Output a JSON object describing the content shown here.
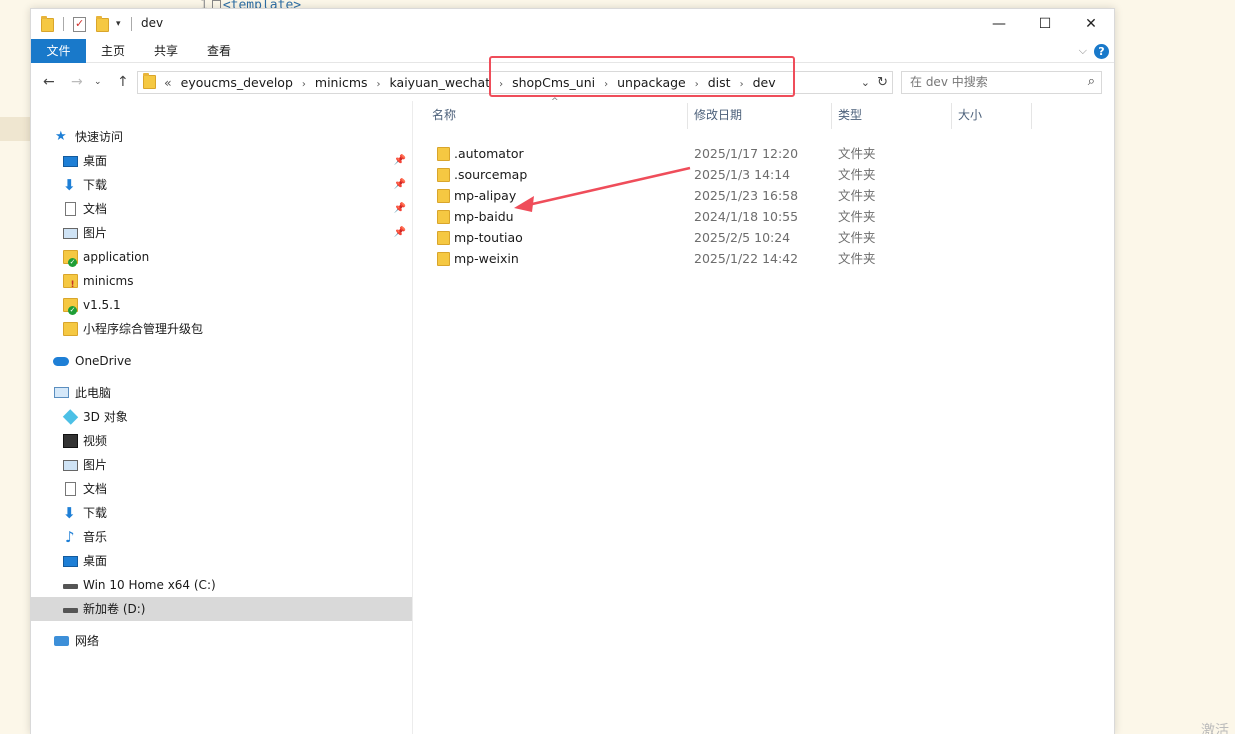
{
  "background": {
    "editor_line_number": "1",
    "editor_code": "<template>",
    "corner_text": "激活"
  },
  "window": {
    "title": "dev",
    "controls": {
      "minimize": "—",
      "maximize": "☐",
      "close": "✕"
    }
  },
  "ribbon": {
    "tabs": [
      "文件",
      "主页",
      "共享",
      "查看"
    ],
    "help": "?"
  },
  "address": {
    "overflow": "«",
    "crumbs": [
      "eyoucms_develop",
      "minicms",
      "kaiyuan_wechat",
      "shopCms_uni",
      "unpackage",
      "dist",
      "dev"
    ],
    "sep": "›"
  },
  "search": {
    "placeholder": "在 dev 中搜索"
  },
  "nav": {
    "quick_access": "快速访问",
    "quick_items": [
      "桌面",
      "下载",
      "文档",
      "图片",
      "application",
      "minicms",
      "v1.5.1",
      "小程序综合管理升级包"
    ],
    "onedrive": "OneDrive",
    "this_pc": "此电脑",
    "pc_items": [
      "3D 对象",
      "视频",
      "图片",
      "文档",
      "下载",
      "音乐",
      "桌面",
      "Win 10 Home x64 (C:)",
      "新加卷 (D:)"
    ],
    "network": "网络"
  },
  "columns": [
    "名称",
    "修改日期",
    "类型",
    "大小"
  ],
  "files": [
    {
      "name": ".automator",
      "date": "2025/1/17 12:20",
      "type": "文件夹"
    },
    {
      "name": ".sourcemap",
      "date": "2025/1/3 14:14",
      "type": "文件夹"
    },
    {
      "name": "mp-alipay",
      "date": "2025/1/23 16:58",
      "type": "文件夹"
    },
    {
      "name": "mp-baidu",
      "date": "2024/1/18 10:55",
      "type": "文件夹"
    },
    {
      "name": "mp-toutiao",
      "date": "2025/2/5 10:24",
      "type": "文件夹"
    },
    {
      "name": "mp-weixin",
      "date": "2025/1/22 14:42",
      "type": "文件夹"
    }
  ],
  "colors": {
    "accent": "#1979ca",
    "highlight": "#ef4d5a",
    "selected_row": "#d9d9d9"
  }
}
